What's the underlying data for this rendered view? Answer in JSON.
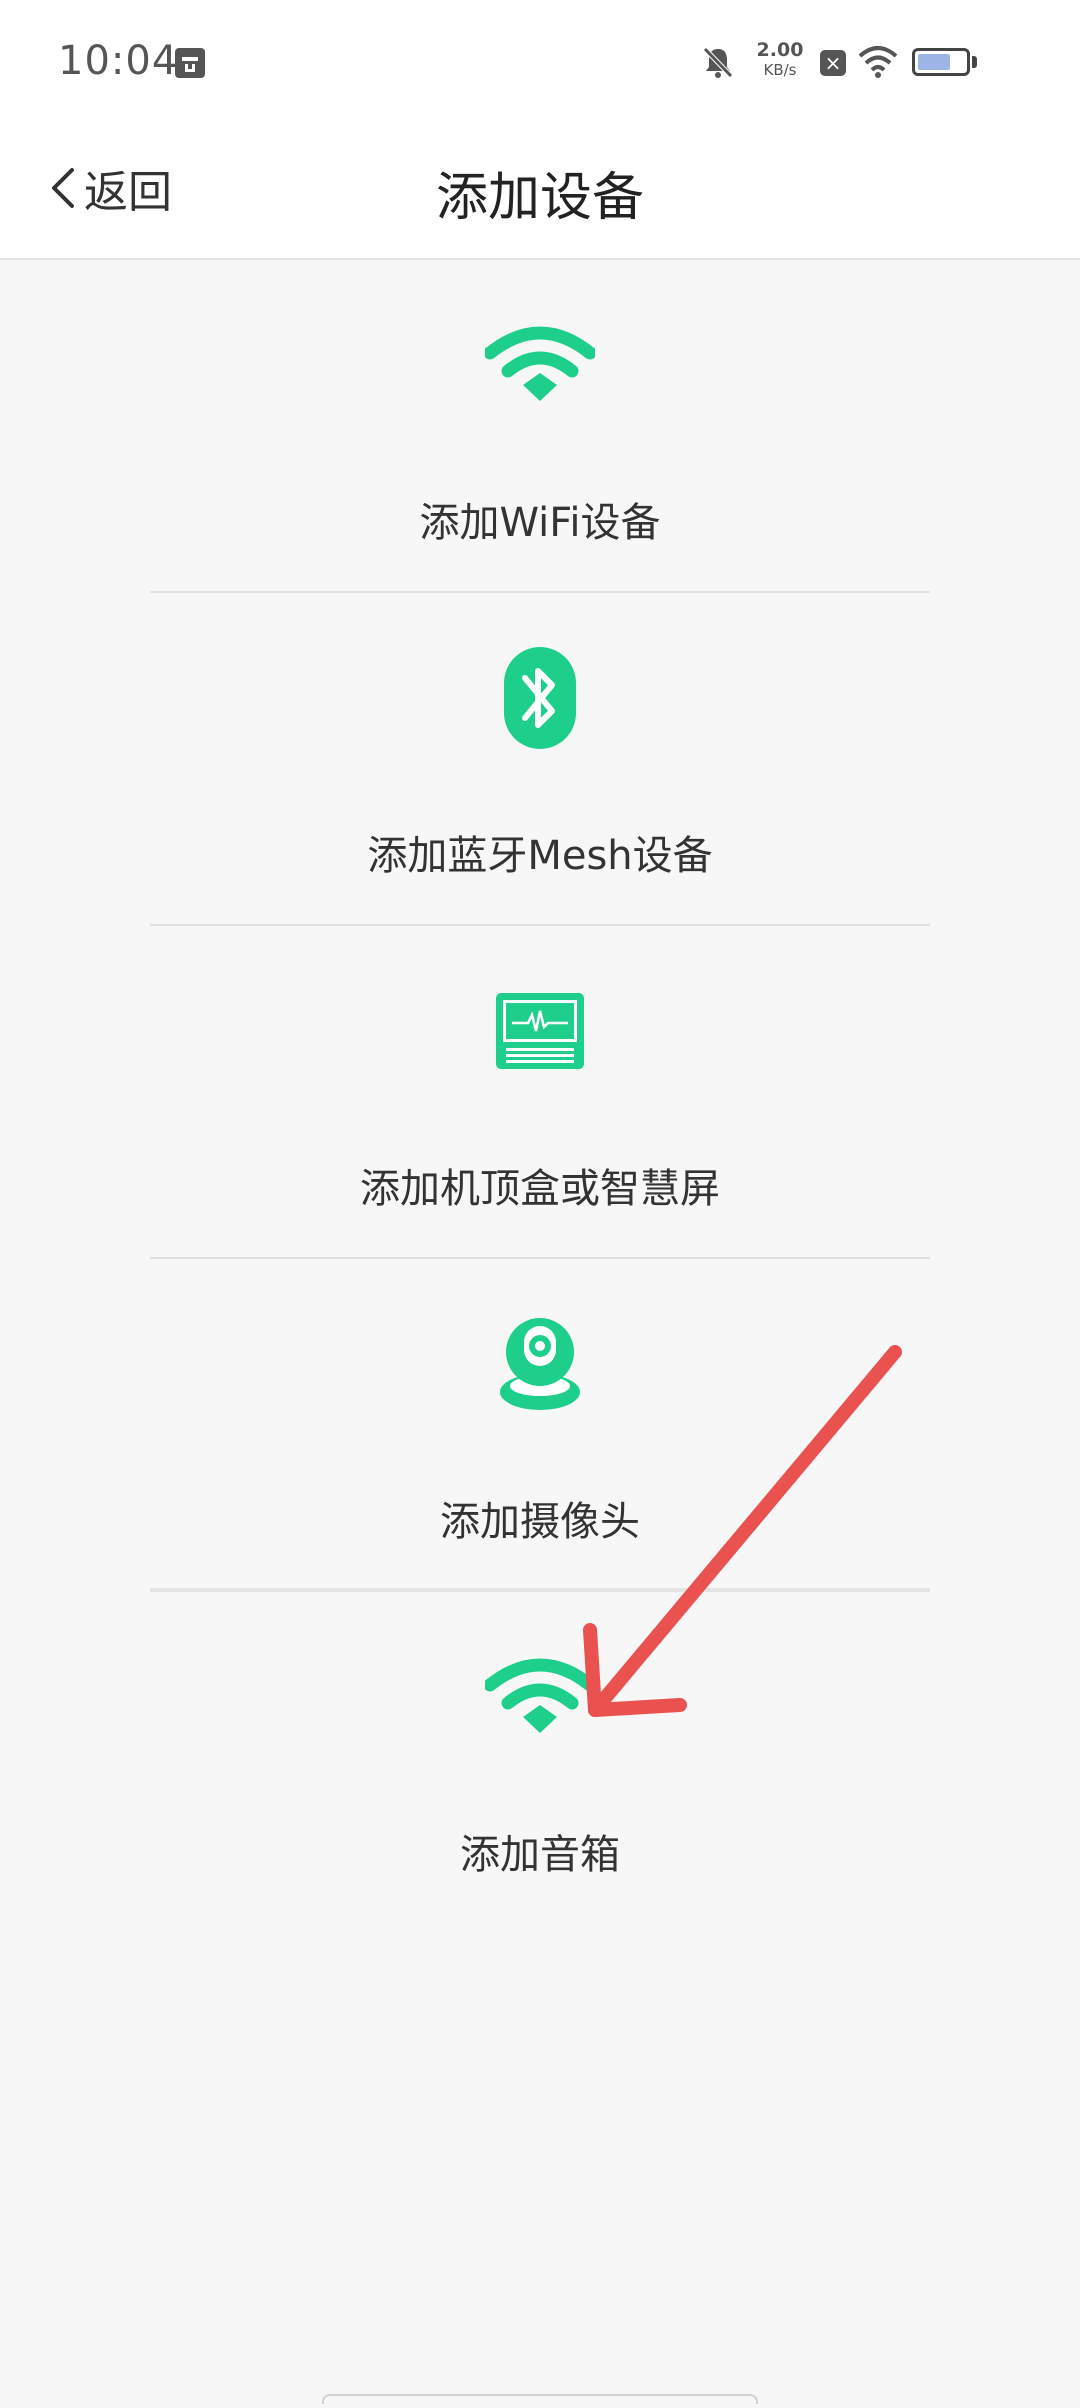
{
  "status_bar": {
    "time": "10:04",
    "net_speed_value": "2.00",
    "net_speed_unit": "KB/s",
    "battery_level_percent": 70
  },
  "header": {
    "back_label": "返回",
    "title": "添加设备"
  },
  "menu": {
    "items": [
      {
        "label": "添加WiFi设备",
        "icon": "wifi-icon"
      },
      {
        "label": "添加蓝牙Mesh设备",
        "icon": "bluetooth-icon"
      },
      {
        "label": "添加机顶盒或智慧屏",
        "icon": "tv-box-icon"
      },
      {
        "label": "添加摄像头",
        "icon": "camera-icon"
      },
      {
        "label": "添加音箱",
        "icon": "wifi-icon"
      }
    ]
  },
  "colors": {
    "accent": "#1ecf8c",
    "annotation_arrow": "#e9524f"
  }
}
